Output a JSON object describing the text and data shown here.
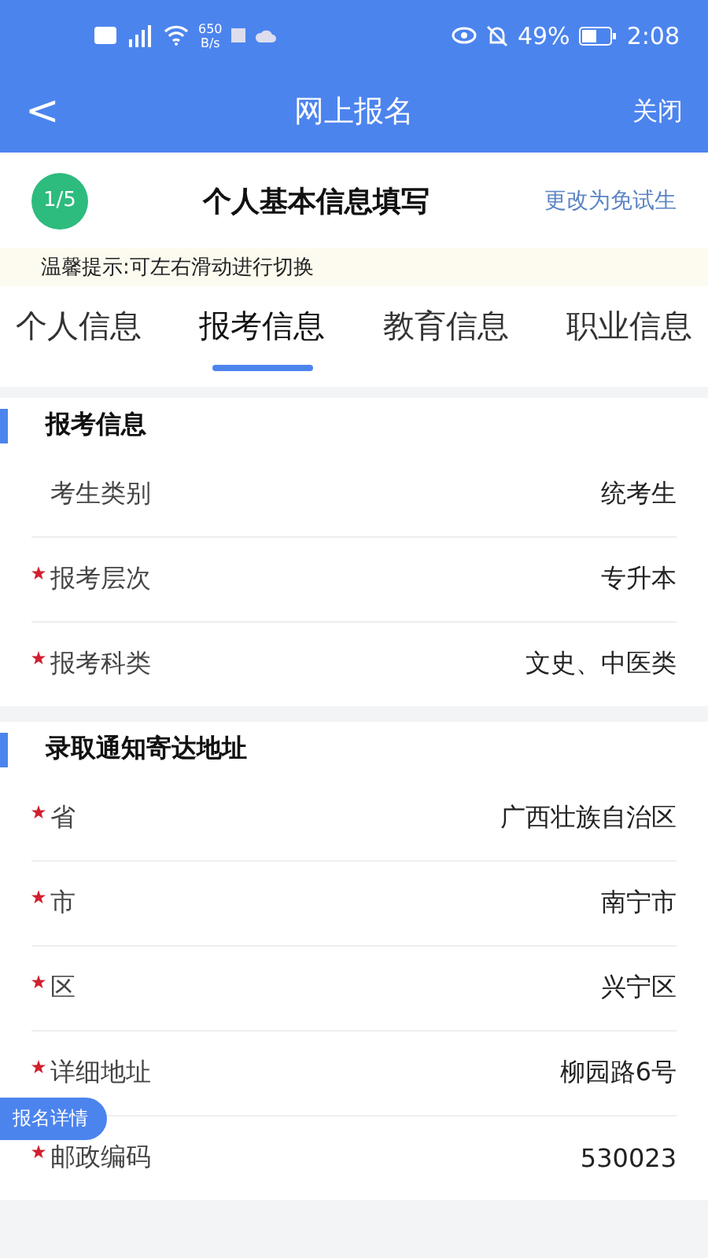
{
  "status_bar": {
    "speed": "650",
    "speed_unit": "B/s",
    "battery": "49%",
    "time": "2:08"
  },
  "nav": {
    "back": "<",
    "title": "网上报名",
    "close": "关闭"
  },
  "header": {
    "step": "1/5",
    "title": "个人基本信息填写",
    "action": "更改为免试生"
  },
  "tip": "温馨提示:可左右滑动进行切换",
  "tabs": [
    {
      "label": "个人信息",
      "selected": false
    },
    {
      "label": "报考信息",
      "selected": true
    },
    {
      "label": "教育信息",
      "selected": false
    },
    {
      "label": "职业信息",
      "selected": false
    }
  ],
  "sections": [
    {
      "title": "报考信息",
      "rows": [
        {
          "label": "考生类别",
          "value": "统考生",
          "required": false
        },
        {
          "label": "报考层次",
          "value": "专升本",
          "required": true
        },
        {
          "label": "报考科类",
          "value": "文史、中医类",
          "required": true
        }
      ]
    },
    {
      "title": "录取通知寄达地址",
      "rows": [
        {
          "label": "省",
          "value": "广西壮族自治区",
          "required": true
        },
        {
          "label": "市",
          "value": "南宁市",
          "required": true
        },
        {
          "label": "区",
          "value": "兴宁区",
          "required": true
        },
        {
          "label": "详细地址",
          "value": "柳园路6号",
          "required": true
        },
        {
          "label": "邮政编码",
          "value": "530023",
          "required": true
        }
      ]
    }
  ],
  "float_button": "报名详情"
}
